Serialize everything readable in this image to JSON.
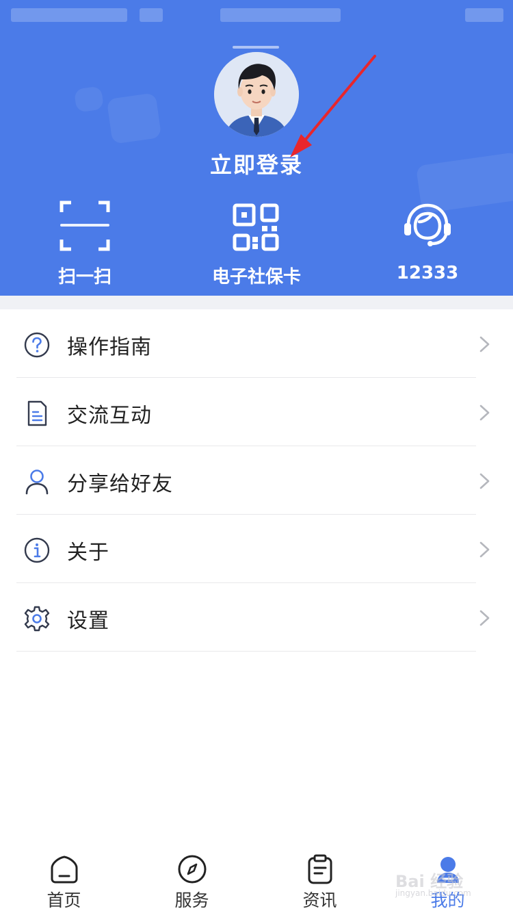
{
  "header": {
    "login_label": "立即登录",
    "background_color": "#4b7be8",
    "quick_actions": [
      {
        "label": "扫一扫",
        "icon": "scan-icon"
      },
      {
        "label": "电子社保卡",
        "icon": "qr-code-icon"
      },
      {
        "label": "12333",
        "icon": "customer-service-icon"
      }
    ]
  },
  "menu": {
    "items": [
      {
        "label": "操作指南",
        "icon": "help-circle-icon"
      },
      {
        "label": "交流互动",
        "icon": "document-icon"
      },
      {
        "label": "分享给好友",
        "icon": "user-icon"
      },
      {
        "label": "关于",
        "icon": "info-icon"
      },
      {
        "label": "设置",
        "icon": "gear-icon"
      }
    ]
  },
  "tabbar": {
    "active_color": "#4b7be8",
    "tabs": [
      {
        "label": "首页",
        "icon": "home-icon",
        "active": false
      },
      {
        "label": "服务",
        "icon": "compass-icon",
        "active": false
      },
      {
        "label": "资讯",
        "icon": "news-icon",
        "active": false
      },
      {
        "label": "我的",
        "icon": "profile-icon",
        "active": true
      }
    ]
  },
  "watermark": {
    "text": "Bai 经验",
    "sub": "jingyan.baidu.com"
  }
}
